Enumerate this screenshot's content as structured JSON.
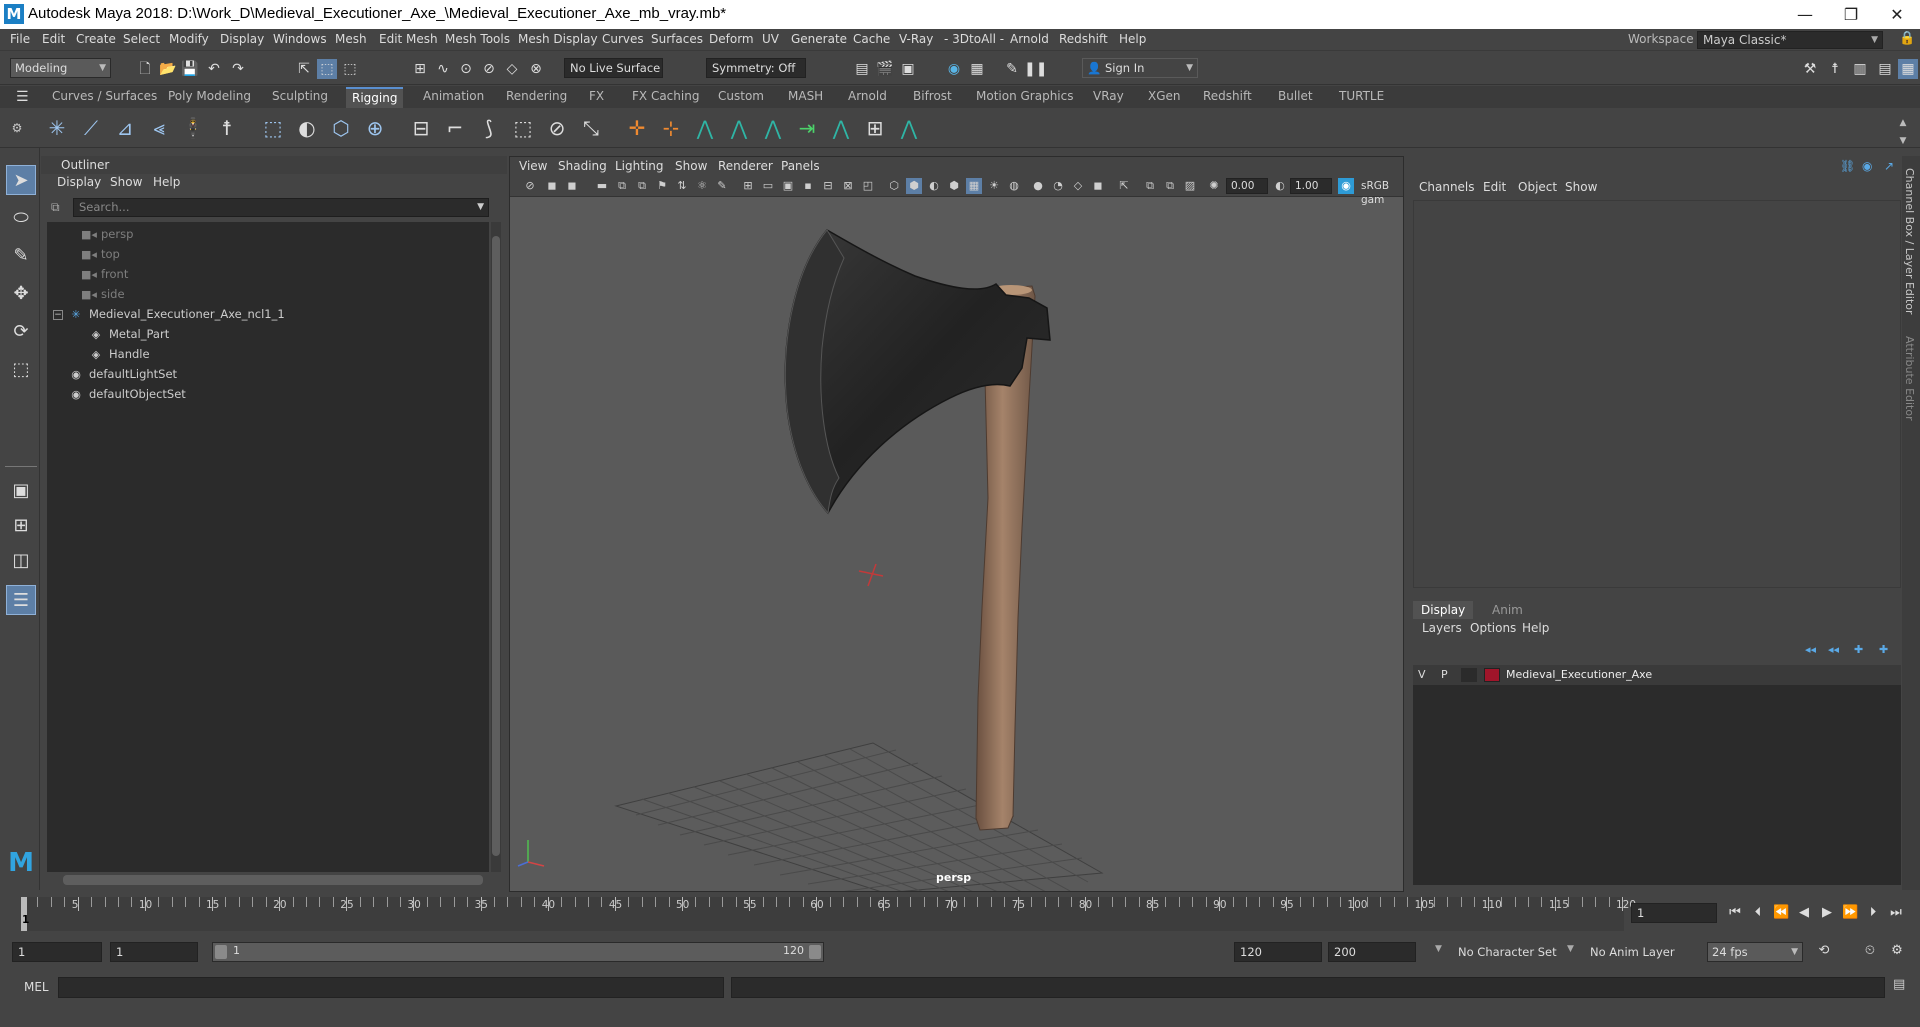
{
  "app": {
    "title": "Autodesk Maya 2018: D:\\Work_D\\Medieval_Executioner_Axe_\\Medieval_Executioner_Axe_mb_vray.mb*",
    "icon_letter": "M"
  },
  "window_controls": {
    "minimize": "—",
    "maximize": "❐",
    "close": "✕"
  },
  "menubar": {
    "items": [
      "File",
      "Edit",
      "Create",
      "Select",
      "Modify",
      "Display",
      "Windows",
      "Mesh",
      "Edit Mesh",
      "Mesh Tools",
      "Mesh Display",
      "Curves",
      "Surfaces",
      "Deform",
      "UV",
      "Generate",
      "Cache",
      "V-Ray",
      "- 3DtoAll -",
      "Arnold",
      "Redshift",
      "Help"
    ],
    "workspace_label": "Workspace :",
    "workspace_value": "Maya Classic*"
  },
  "statusline": {
    "mode": "Modeling",
    "live_surface": "No Live Surface",
    "symmetry": "Symmetry: Off",
    "sign_in": "Sign In"
  },
  "shelf": {
    "tabs": [
      "Curves / Surfaces",
      "Poly Modeling",
      "Sculpting",
      "Rigging",
      "Animation",
      "Rendering",
      "FX",
      "FX Caching",
      "Custom",
      "MASH",
      "Arnold",
      "Bifrost",
      "Motion Graphics",
      "VRay",
      "XGen",
      "Redshift",
      "Bullet",
      "TURTLE"
    ],
    "active_tab": "Rigging"
  },
  "outliner": {
    "title": "Outliner",
    "menu": [
      "Display",
      "Show",
      "Help"
    ],
    "search_placeholder": "Search...",
    "items": [
      {
        "label": "persp",
        "dim": true
      },
      {
        "label": "top",
        "dim": true
      },
      {
        "label": "front",
        "dim": true
      },
      {
        "label": "side",
        "dim": true
      },
      {
        "label": "Medieval_Executioner_Axe_ncl1_1",
        "dim": false
      },
      {
        "label": "Metal_Part",
        "dim": false
      },
      {
        "label": "Handle",
        "dim": false
      },
      {
        "label": "defaultLightSet",
        "dim": false
      },
      {
        "label": "defaultObjectSet",
        "dim": false
      }
    ]
  },
  "viewport": {
    "menu": [
      "View",
      "Shading",
      "Lighting",
      "Show",
      "Renderer",
      "Panels"
    ],
    "exposure": "0.00",
    "gamma": "1.00",
    "color_space": "sRGB gam",
    "camera_label": "persp"
  },
  "channelbox": {
    "menu": [
      "Channels",
      "Edit",
      "Object",
      "Show"
    ],
    "side_tabs": [
      "Channel Box / Layer Editor",
      "Attribute Editor"
    ]
  },
  "layer_editor": {
    "tabs": [
      "Display",
      "Anim"
    ],
    "active_tab": "Display",
    "menu": [
      "Layers",
      "Options",
      "Help"
    ],
    "layer": {
      "v": "V",
      "p": "P",
      "name": "Medieval_Executioner_Axe",
      "color": "#a0152a"
    }
  },
  "timeslider": {
    "ticks": [
      5,
      10,
      15,
      20,
      25,
      30,
      35,
      40,
      45,
      50,
      55,
      60,
      65,
      70,
      75,
      80,
      85,
      90,
      95,
      100,
      105,
      110,
      115,
      120
    ],
    "current_marker": "1",
    "current_frame": "1"
  },
  "rangeslider": {
    "start": "1",
    "anim_start": "1",
    "range_start": "1",
    "range_end": "120",
    "end": "120",
    "anim_end": "200",
    "character_set": "No Character Set",
    "anim_layer": "No Anim Layer",
    "fps": "24 fps"
  },
  "cmdline": {
    "label": "MEL"
  },
  "colors": {
    "accent": "#5a8fd0",
    "panel": "#444444",
    "field": "#2b2b2b",
    "viewport": "#5a5a5a"
  }
}
